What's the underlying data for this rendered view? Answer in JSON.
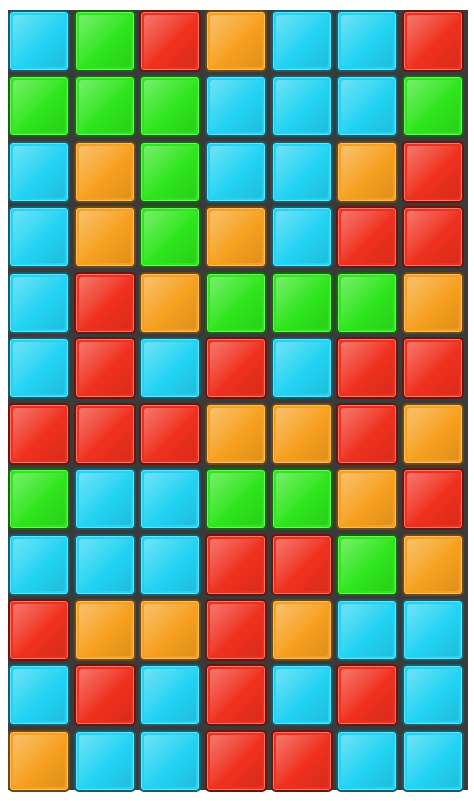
{
  "colors": {
    "blue": "#22d3f3",
    "green": "#2ee61c",
    "red": "#f0301e",
    "orange": "#f7a01f"
  },
  "grid": {
    "columns": 7,
    "rows": 12,
    "cells": [
      [
        "blue",
        "green",
        "red",
        "orange",
        "blue",
        "blue",
        "red"
      ],
      [
        "green",
        "green",
        "green",
        "blue",
        "blue",
        "blue",
        "green"
      ],
      [
        "blue",
        "orange",
        "green",
        "blue",
        "blue",
        "orange",
        "red"
      ],
      [
        "blue",
        "orange",
        "green",
        "orange",
        "blue",
        "red",
        "red"
      ],
      [
        "blue",
        "red",
        "orange",
        "green",
        "green",
        "green",
        "orange"
      ],
      [
        "blue",
        "red",
        "blue",
        "red",
        "blue",
        "red",
        "red"
      ],
      [
        "red",
        "red",
        "red",
        "orange",
        "orange",
        "red",
        "orange"
      ],
      [
        "green",
        "blue",
        "blue",
        "green",
        "green",
        "orange",
        "red"
      ],
      [
        "blue",
        "blue",
        "blue",
        "red",
        "red",
        "green",
        "orange"
      ],
      [
        "red",
        "orange",
        "orange",
        "red",
        "orange",
        "blue",
        "blue"
      ],
      [
        "blue",
        "red",
        "blue",
        "red",
        "blue",
        "red",
        "blue"
      ],
      [
        "orange",
        "blue",
        "blue",
        "red",
        "red",
        "blue",
        "blue"
      ]
    ]
  }
}
